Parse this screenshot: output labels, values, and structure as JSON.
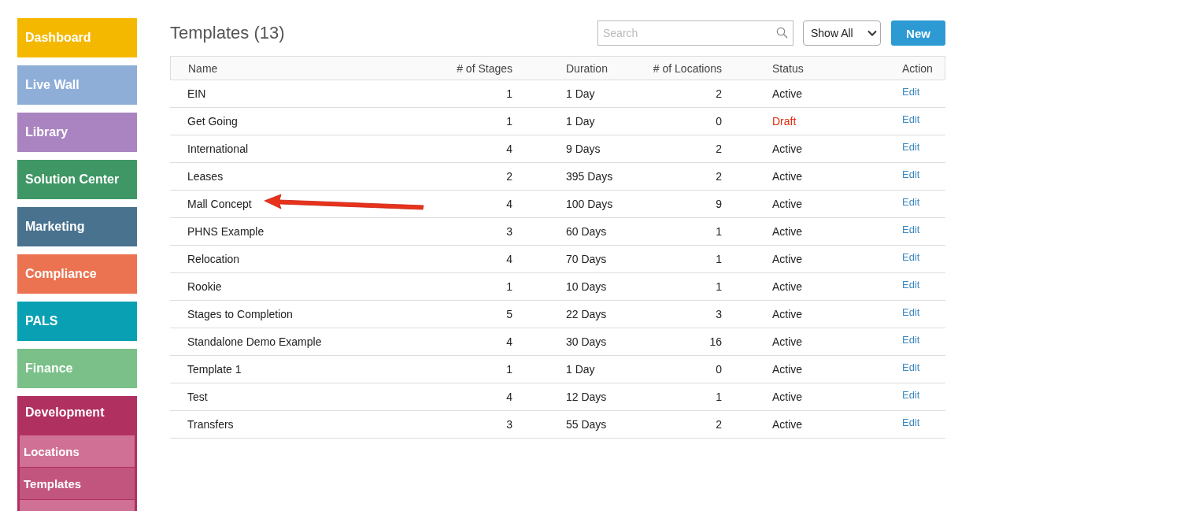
{
  "sidebar": {
    "items": [
      {
        "label": "Dashboard",
        "color": "#f5b800"
      },
      {
        "label": "Live Wall",
        "color": "#8eaed8"
      },
      {
        "label": "Library",
        "color": "#a984c0"
      },
      {
        "label": "Solution Center",
        "color": "#3f9765"
      },
      {
        "label": "Marketing",
        "color": "#49728f"
      },
      {
        "label": "Compliance",
        "color": "#eb7352"
      },
      {
        "label": "PALS",
        "color": "#0aa0b3"
      },
      {
        "label": "Finance",
        "color": "#7bc088"
      },
      {
        "label": "Development",
        "color": "#b03060",
        "expanded": true,
        "children": [
          {
            "label": "Locations",
            "selected": false
          },
          {
            "label": "Templates",
            "selected": true
          },
          {
            "selected": false
          }
        ]
      }
    ]
  },
  "header": {
    "title": "Templates (13)",
    "search": {
      "placeholder": "Search"
    },
    "filter": {
      "value": "Show All"
    },
    "new_button": "New"
  },
  "table": {
    "columns": [
      "Name",
      "# of Stages",
      "Duration",
      "# of Locations",
      "Status",
      "Action"
    ],
    "rows": [
      {
        "name": "EIN",
        "stages": "1",
        "duration": "1 Day",
        "locations": "2",
        "status": "Active",
        "draft": false,
        "action": "Edit"
      },
      {
        "name": "Get Going",
        "stages": "1",
        "duration": "1 Day",
        "locations": "0",
        "status": "Draft",
        "draft": true,
        "action": "Edit"
      },
      {
        "name": "International",
        "stages": "4",
        "duration": "9 Days",
        "locations": "2",
        "status": "Active",
        "draft": false,
        "action": "Edit"
      },
      {
        "name": "Leases",
        "stages": "2",
        "duration": "395 Days",
        "locations": "2",
        "status": "Active",
        "draft": false,
        "action": "Edit"
      },
      {
        "name": "Mall Concept",
        "stages": "4",
        "duration": "100 Days",
        "locations": "9",
        "status": "Active",
        "draft": false,
        "action": "Edit",
        "annotated": true
      },
      {
        "name": "PHNS Example",
        "stages": "3",
        "duration": "60 Days",
        "locations": "1",
        "status": "Active",
        "draft": false,
        "action": "Edit"
      },
      {
        "name": "Relocation",
        "stages": "4",
        "duration": "70 Days",
        "locations": "1",
        "status": "Active",
        "draft": false,
        "action": "Edit"
      },
      {
        "name": "Rookie",
        "stages": "1",
        "duration": "10 Days",
        "locations": "1",
        "status": "Active",
        "draft": false,
        "action": "Edit"
      },
      {
        "name": "Stages to Completion",
        "stages": "5",
        "duration": "22 Days",
        "locations": "3",
        "status": "Active",
        "draft": false,
        "action": "Edit"
      },
      {
        "name": "Standalone Demo Example",
        "stages": "4",
        "duration": "30 Days",
        "locations": "16",
        "status": "Active",
        "draft": false,
        "action": "Edit"
      },
      {
        "name": "Template 1",
        "stages": "1",
        "duration": "1 Day",
        "locations": "0",
        "status": "Active",
        "draft": false,
        "action": "Edit"
      },
      {
        "name": "Test",
        "stages": "4",
        "duration": "12 Days",
        "locations": "1",
        "status": "Active",
        "draft": false,
        "action": "Edit"
      },
      {
        "name": "Transfers",
        "stages": "3",
        "duration": "55 Days",
        "locations": "2",
        "status": "Active",
        "draft": false,
        "action": "Edit"
      }
    ]
  }
}
